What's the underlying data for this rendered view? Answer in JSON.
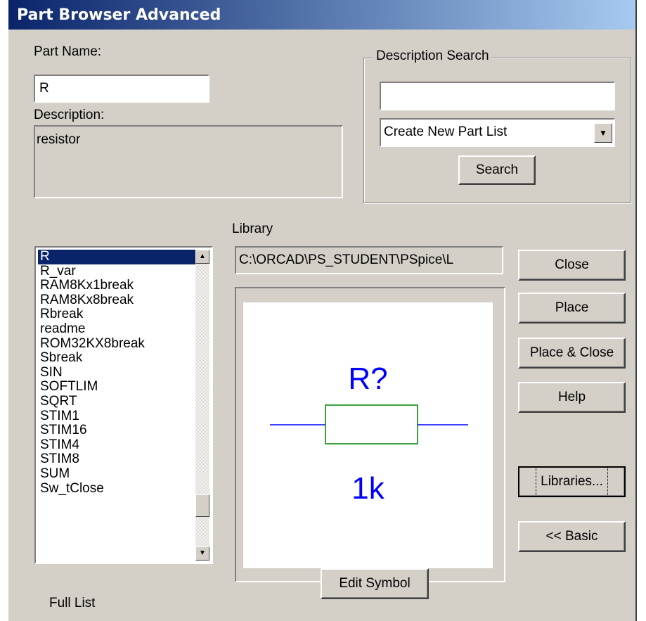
{
  "window": {
    "title": "Part Browser Advanced"
  },
  "part_name": {
    "label": "Part Name:",
    "value": "R"
  },
  "description": {
    "label": "Description:",
    "value": "resistor"
  },
  "description_search": {
    "group_label": "Description Search",
    "input_value": "",
    "dropdown_value": "Create New Part List",
    "search_button": "Search"
  },
  "library": {
    "label": "Library",
    "path": "C:\\ORCAD\\PS_STUDENT\\PSpice\\L"
  },
  "parts_list": {
    "items": [
      "R",
      "R_var",
      "RAM8Kx1break",
      "RAM8Kx8break",
      "Rbreak",
      "readme",
      "ROM32KX8break",
      "Sbreak",
      "SIN",
      "SOFTLIM",
      "SQRT",
      "STIM1",
      "STIM16",
      "STIM4",
      "STIM8",
      "SUM",
      "Sw_tClose"
    ],
    "selected": "R",
    "footer_label": "Full List"
  },
  "preview": {
    "reference": "R?",
    "value": "1k",
    "colors": {
      "text": "#0000ff",
      "wire": "#0000ff",
      "body": "#008000"
    }
  },
  "buttons": {
    "close": "Close",
    "place": "Place",
    "place_close": "Place & Close",
    "help": "Help",
    "libraries": "Libraries...",
    "basic": "<< Basic",
    "edit_symbol": "Edit Symbol"
  },
  "icons": {
    "scroll_up": "triangle-up-icon",
    "scroll_down": "triangle-down-icon",
    "dropdown": "triangle-down-icon"
  }
}
